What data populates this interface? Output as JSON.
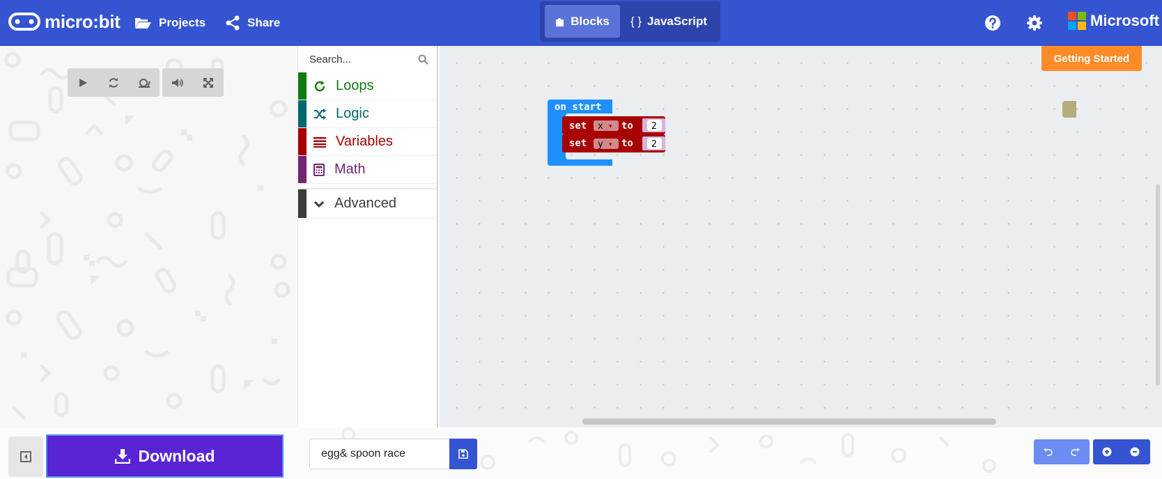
{
  "header": {
    "app_name": "micro:bit",
    "projects_label": "Projects",
    "share_label": "Share",
    "mode_blocks_label": "Blocks",
    "mode_js_label": "JavaScript",
    "mode_js_glyph": "{ }",
    "brand_label": "Microsoft",
    "icons": [
      "micro-bit-logo-icon",
      "folder-open-icon",
      "share-icon",
      "puzzle-icon",
      "help-icon",
      "gear-icon",
      "microsoft-logo-icon"
    ]
  },
  "simulator": {
    "controls": [
      "play-icon",
      "restart-icon",
      "slow-mo-icon",
      "mute-icon",
      "fullscreen-icon"
    ]
  },
  "toolbox": {
    "search_placeholder": "Search...",
    "categories": [
      {
        "label": "Loops",
        "color": "#107c10",
        "icon": "loop-icon"
      },
      {
        "label": "Logic",
        "color": "#006970",
        "icon": "shuffle-icon"
      },
      {
        "label": "Variables",
        "color": "#a80000",
        "icon": "list-icon"
      },
      {
        "label": "Math",
        "color": "#712672",
        "icon": "calculator-icon"
      }
    ],
    "advanced_label": "Advanced",
    "advanced_color": "#3c3c3c"
  },
  "workspace": {
    "getting_started_label": "Getting Started",
    "blocks": {
      "on_start_label": "on start",
      "set_label": "set",
      "to_label": "to",
      "statements": [
        {
          "variable": "x",
          "value": "2"
        },
        {
          "variable": "y",
          "value": "2"
        }
      ]
    }
  },
  "footer": {
    "download_label": "Download",
    "project_name": "egg& spoon race",
    "icons": [
      "collapse-simulator-icon",
      "download-icon",
      "save-icon",
      "undo-icon",
      "redo-icon",
      "zoom-in-icon",
      "zoom-out-icon"
    ]
  },
  "colors": {
    "header_bg": "#3454d1",
    "download_bg": "#5824d4",
    "getting_started_bg": "#ff8b27",
    "on_start_block": "#1e90ff",
    "variables_block": "#a80000"
  }
}
